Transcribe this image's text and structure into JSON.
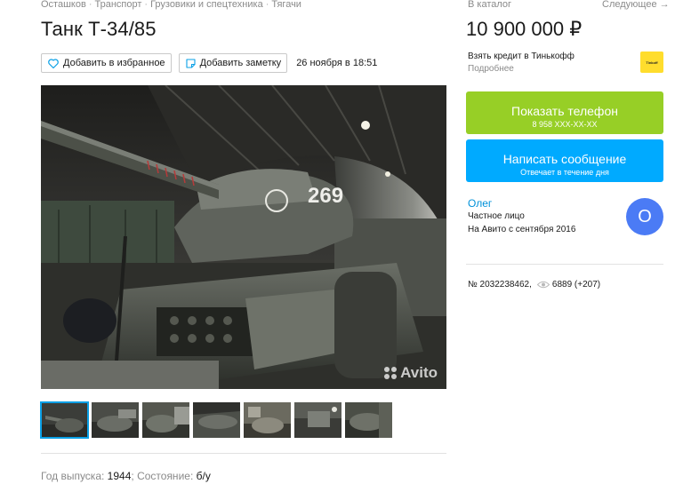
{
  "breadcrumb": [
    "Осташков",
    "Транспорт",
    "Грузовики и спецтехника",
    "Тягачи"
  ],
  "title": "Танк Т-34/85",
  "actions": {
    "favorite_label": "Добавить в избранное",
    "note_label": "Добавить заметку",
    "date": "26 ноября в 18:51"
  },
  "gallery": {
    "watermark": "Avito",
    "main_photo_number": "269",
    "thumb_count": 7
  },
  "params": {
    "year_label": "Год выпуска:",
    "year_value": "1944",
    "condition_label": "Состояние:",
    "condition_value": "б/у",
    "separator": ";"
  },
  "nav": {
    "catalog": "В каталог",
    "next": "Следующее →"
  },
  "price": "10 900 000 ₽",
  "credit": {
    "text": "Взять кредит в Тинькофф",
    "more": "Подробнее",
    "logo_text": "Tinkoff"
  },
  "contact": {
    "phone_label": "Показать телефон",
    "phone_number": "8 958 XXX-XX-XX",
    "message_label": "Написать сообщение",
    "message_sub": "Отвечает в течение дня"
  },
  "seller": {
    "name": "Олег",
    "type": "Частное лицо",
    "since": "На Авито с сентября 2016",
    "avatar_letter": "О"
  },
  "stats": {
    "ad_number": "№ 2032238462,",
    "views": "6889 (+207)"
  },
  "colors": {
    "phone_button": "#97cf26",
    "message_button": "#00aaff",
    "seller_link": "#0091d9",
    "avatar": "#4b7bf5",
    "tinkoff": "#ffdd2d"
  }
}
